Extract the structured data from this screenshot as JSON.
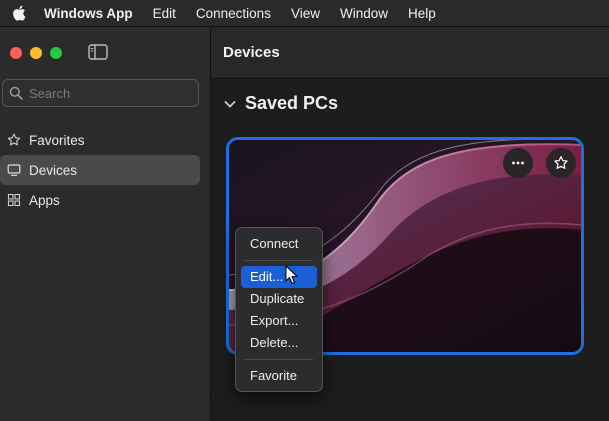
{
  "menubar": {
    "app_name": "Windows App",
    "items": [
      "Edit",
      "Connections",
      "View",
      "Window",
      "Help"
    ]
  },
  "window": {
    "traffic_lights": {
      "close": "#ff5f57",
      "minimize": "#febc2e",
      "zoom": "#28c840"
    }
  },
  "sidebar": {
    "search_placeholder": "Search",
    "items": [
      {
        "label": "Favorites",
        "icon": "star-icon",
        "selected": false
      },
      {
        "label": "Devices",
        "icon": "monitor-icon",
        "selected": true
      },
      {
        "label": "Apps",
        "icon": "apps-grid-icon",
        "selected": false
      }
    ]
  },
  "main": {
    "title": "Devices",
    "section_title": "Saved PCs",
    "accent": "#1f6fe0"
  },
  "context_menu": {
    "items": [
      {
        "label": "Connect",
        "highlighted": false
      },
      {
        "label": "Edit...",
        "highlighted": true
      },
      {
        "label": "Duplicate",
        "highlighted": false
      },
      {
        "label": "Export...",
        "highlighted": false
      },
      {
        "label": "Delete...",
        "highlighted": false
      },
      {
        "label": "Favorite",
        "highlighted": false
      }
    ]
  }
}
